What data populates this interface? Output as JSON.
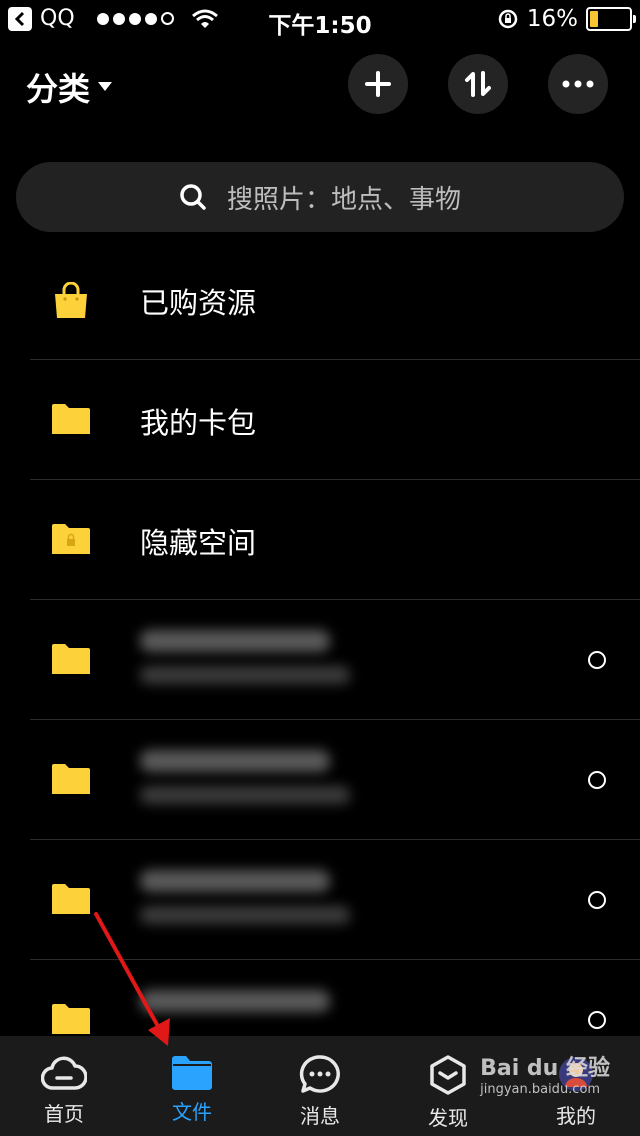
{
  "status_bar": {
    "carrier": "QQ",
    "time": "下午1:50",
    "battery": "16%",
    "battery_level": 0.16
  },
  "header": {
    "title": "分类",
    "buttons": [
      "plus-icon",
      "sort-icon",
      "more-icon"
    ]
  },
  "search": {
    "placeholder": "搜照片：地点、事物"
  },
  "list": {
    "items": [
      {
        "name": "已购资源",
        "icon": "shopping-bag-icon"
      },
      {
        "name": "我的卡包",
        "icon": "folder-icon"
      },
      {
        "name": "隐藏空间",
        "icon": "locked-folder-icon"
      }
    ],
    "blurred_count": 4
  },
  "tabs": [
    {
      "label": "首页",
      "icon": "cloud-icon",
      "active": false
    },
    {
      "label": "文件",
      "icon": "folder-icon",
      "active": true
    },
    {
      "label": "消息",
      "icon": "chat-icon",
      "active": false
    },
    {
      "label": "发现",
      "icon": "cube-icon",
      "active": false
    },
    {
      "label": "我的",
      "icon": "profile-icon",
      "active": false
    }
  ],
  "watermark": {
    "brand": "Bai du 经验",
    "url": "jingyan.baidu.com"
  },
  "colors": {
    "accent": "#2aa3ff",
    "folder": "#fdd13a",
    "background": "#000000"
  }
}
